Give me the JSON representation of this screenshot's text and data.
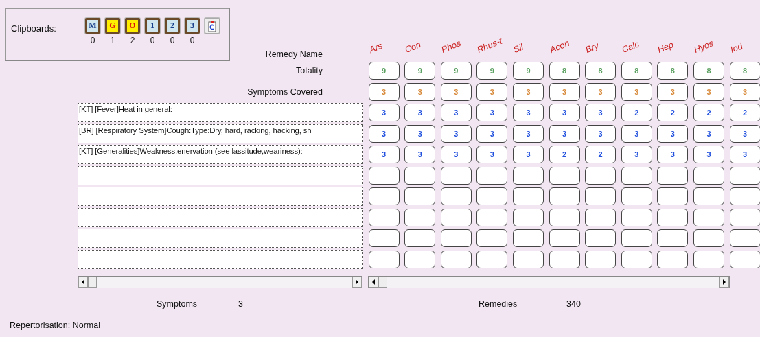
{
  "clipboards": {
    "label": "Clipboards:",
    "items": [
      {
        "letter": "M",
        "count": "0",
        "highlight": false
      },
      {
        "letter": "G",
        "count": "1",
        "highlight": true
      },
      {
        "letter": "O",
        "count": "2",
        "highlight": true
      },
      {
        "letter": "1",
        "count": "0",
        "highlight": false
      },
      {
        "letter": "2",
        "count": "0",
        "highlight": false
      },
      {
        "letter": "3",
        "count": "0",
        "highlight": false
      }
    ]
  },
  "grid": {
    "remedy_label": "Remedy Name",
    "totality_label": "Totality",
    "covered_label": "Symptoms Covered",
    "symptoms": [
      "[KT] [Fever]Heat in general:",
      "[BR] [Respiratory System]Cough:Type:Dry, hard, racking, hacking, sh",
      "[KT] [Generalities]Weakness,enervation (see lassitude,weariness):"
    ],
    "remedies": [
      {
        "name": "Ars",
        "totality": "9",
        "covered": "3",
        "scores": [
          "3",
          "3",
          "3"
        ]
      },
      {
        "name": "Con",
        "totality": "9",
        "covered": "3",
        "scores": [
          "3",
          "3",
          "3"
        ]
      },
      {
        "name": "Phos",
        "totality": "9",
        "covered": "3",
        "scores": [
          "3",
          "3",
          "3"
        ]
      },
      {
        "name": "Rhus-t",
        "totality": "9",
        "covered": "3",
        "scores": [
          "3",
          "3",
          "3"
        ]
      },
      {
        "name": "Sil",
        "totality": "9",
        "covered": "3",
        "scores": [
          "3",
          "3",
          "3"
        ]
      },
      {
        "name": "Acon",
        "totality": "8",
        "covered": "3",
        "scores": [
          "3",
          "3",
          "2"
        ]
      },
      {
        "name": "Bry",
        "totality": "8",
        "covered": "3",
        "scores": [
          "3",
          "3",
          "2"
        ]
      },
      {
        "name": "Calc",
        "totality": "8",
        "covered": "3",
        "scores": [
          "2",
          "3",
          "3"
        ]
      },
      {
        "name": "Hep",
        "totality": "8",
        "covered": "3",
        "scores": [
          "2",
          "3",
          "3"
        ]
      },
      {
        "name": "Hyos",
        "totality": "8",
        "covered": "3",
        "scores": [
          "2",
          "3",
          "3"
        ]
      },
      {
        "name": "Iod",
        "totality": "8",
        "covered": "3",
        "scores": [
          "2",
          "3",
          "3"
        ]
      }
    ]
  },
  "footer": {
    "symptoms_label": "Symptoms",
    "symptoms_count": "3",
    "remedies_label": "Remedies",
    "remedies_count": "340"
  },
  "status_bar": "Repertorisation: Normal"
}
